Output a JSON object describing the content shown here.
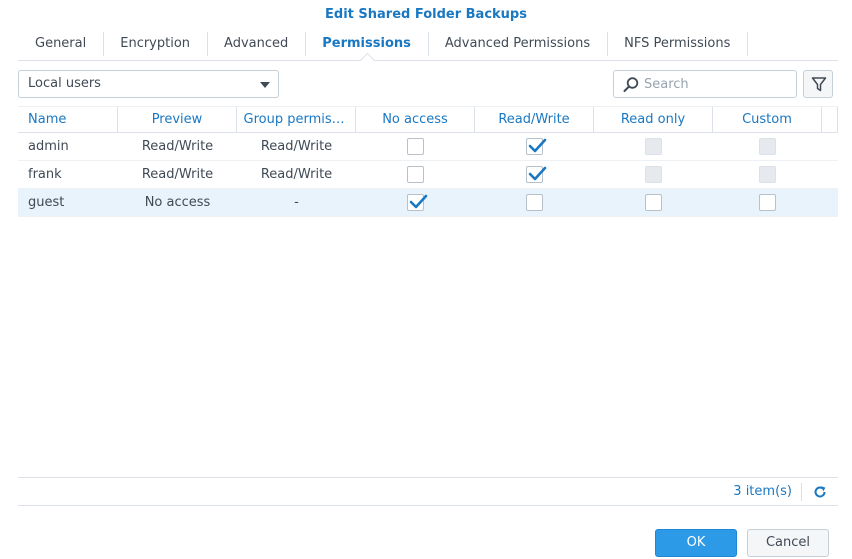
{
  "window": {
    "title": "Edit Shared Folder Backups"
  },
  "tabs": [
    {
      "label": "General"
    },
    {
      "label": "Encryption"
    },
    {
      "label": "Advanced"
    },
    {
      "label": "Permissions",
      "active": true
    },
    {
      "label": "Advanced Permissions"
    },
    {
      "label": "NFS Permissions"
    }
  ],
  "toolbar": {
    "user_type_selected": "Local users",
    "search_placeholder": "Search"
  },
  "table": {
    "columns": [
      "Name",
      "Preview",
      "Group permiss...",
      "No access",
      "Read/Write",
      "Read only",
      "Custom"
    ],
    "rows": [
      {
        "name": "admin",
        "preview": "Read/Write",
        "group": "Read/Write",
        "no_access": false,
        "read_write": true,
        "read_only": false,
        "custom": false
      },
      {
        "name": "frank",
        "preview": "Read/Write",
        "group": "Read/Write",
        "no_access": false,
        "read_write": true,
        "read_only": false,
        "custom": false
      },
      {
        "name": "guest",
        "preview": "No access",
        "group": "-",
        "no_access": true,
        "read_write": false,
        "read_only": false,
        "custom": false
      }
    ]
  },
  "pager": {
    "count_label": "3 item(s)"
  },
  "buttons": {
    "ok": "OK",
    "cancel": "Cancel"
  },
  "colors": {
    "accent": "#1a78c2",
    "primary_button": "#2d9ae8",
    "read_write_text": "#e58a1a",
    "no_access_text": "#e8412c",
    "selected_row": "#e8f3fc"
  },
  "icons": {
    "search": "search-icon",
    "filter": "filter-icon",
    "dropdown": "chevron-down-icon",
    "refresh": "refresh-icon",
    "check": "check-icon"
  }
}
